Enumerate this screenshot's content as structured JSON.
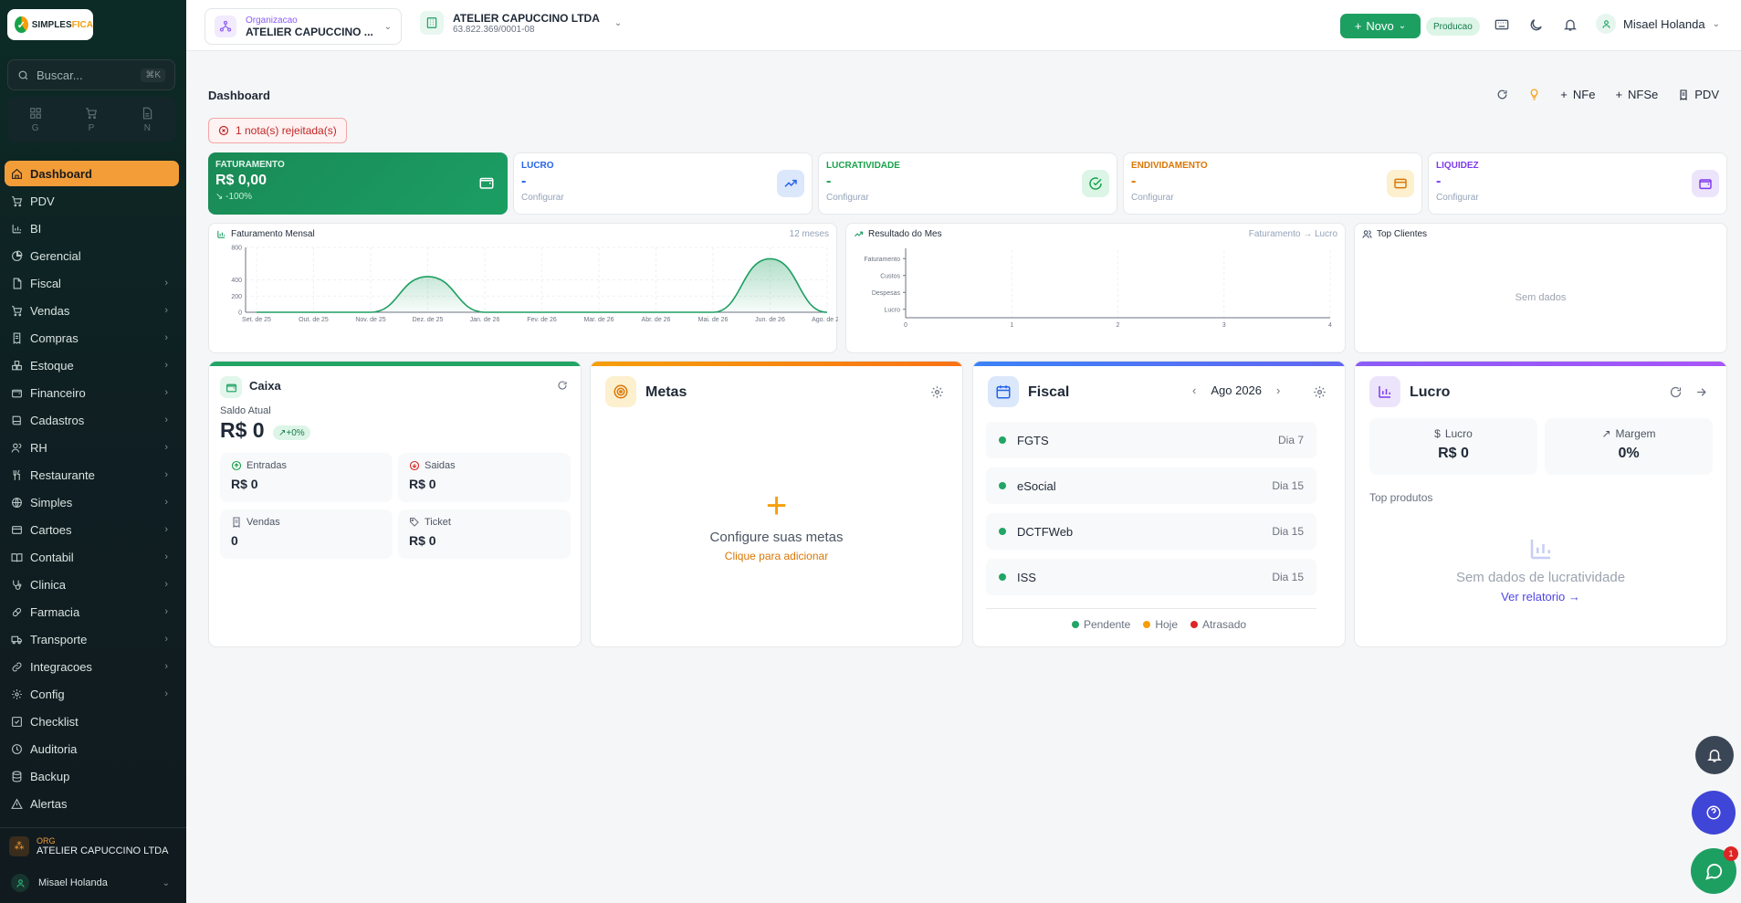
{
  "brand": {
    "logo_a": "SIMPLES",
    "logo_b": "FICA"
  },
  "sidebar": {
    "search_placeholder": "Buscar...",
    "search_shortcut": "⌘K",
    "quick": [
      {
        "label": "G"
      },
      {
        "label": "P"
      },
      {
        "label": "N"
      }
    ],
    "items": [
      {
        "label": "Dashboard",
        "icon": "home-icon"
      },
      {
        "label": "PDV",
        "icon": "cart-icon"
      },
      {
        "label": "BI",
        "icon": "bar-chart-icon"
      },
      {
        "label": "Gerencial",
        "icon": "pie-chart-icon"
      },
      {
        "label": "Fiscal",
        "icon": "file-icon"
      },
      {
        "label": "Vendas",
        "icon": "cart-icon"
      },
      {
        "label": "Compras",
        "icon": "receipt-icon"
      },
      {
        "label": "Estoque",
        "icon": "boxes-icon"
      },
      {
        "label": "Financeiro",
        "icon": "wallet-icon"
      },
      {
        "label": "Cadastros",
        "icon": "book-icon"
      },
      {
        "label": "RH",
        "icon": "users-icon"
      },
      {
        "label": "Restaurante",
        "icon": "utensils-icon"
      },
      {
        "label": "Simples",
        "icon": "globe-icon"
      },
      {
        "label": "Cartoes",
        "icon": "card-icon"
      },
      {
        "label": "Contabil",
        "icon": "book-open-icon"
      },
      {
        "label": "Clinica",
        "icon": "stethoscope-icon"
      },
      {
        "label": "Farmacia",
        "icon": "pill-icon"
      },
      {
        "label": "Transporte",
        "icon": "truck-icon"
      },
      {
        "label": "Integracoes",
        "icon": "link-icon"
      },
      {
        "label": "Config",
        "icon": "gear-icon"
      },
      {
        "label": "Checklist",
        "icon": "checklist-icon"
      },
      {
        "label": "Auditoria",
        "icon": "clock-icon"
      },
      {
        "label": "Backup",
        "icon": "database-icon"
      },
      {
        "label": "Alertas",
        "icon": "warning-icon"
      }
    ],
    "org_label": "ORG",
    "org_name": "ATELIER CAPUCCINO LTDA",
    "user_name": "Misael Holanda"
  },
  "topbar": {
    "org_caption": "Organizacao",
    "org_name": "ATELIER CAPUCCINO ...",
    "company_name": "ATELIER CAPUCCINO LTDA",
    "company_cnpj": "63.822.369/0001-08",
    "new_label": "Novo",
    "env_label": "Producao",
    "user_name": "Misael Holanda"
  },
  "page": {
    "title": "Dashboard",
    "actions": {
      "nfe": "NFe",
      "nfse": "NFSe",
      "pdv": "PDV"
    },
    "alert": "1 nota(s) rejeitada(s)"
  },
  "kpis": [
    {
      "label": "FATURAMENTO",
      "value": "R$ 0,00",
      "sub": "↘ -100%",
      "color": "#1b9e63"
    },
    {
      "label": "LUCRO",
      "value": "-",
      "sub": "Configurar",
      "color": "#2563eb"
    },
    {
      "label": "LUCRATIVIDADE",
      "value": "-",
      "sub": "Configurar",
      "color": "#16a34a"
    },
    {
      "label": "ENDIVIDAMENTO",
      "value": "-",
      "sub": "Configurar",
      "color": "#d97706"
    },
    {
      "label": "LIQUIDEZ",
      "value": "-",
      "sub": "Configurar",
      "color": "#7c3aed"
    }
  ],
  "chart_faturamento": {
    "title": "Faturamento Mensal",
    "range_label": "12 meses"
  },
  "chart_data": [
    {
      "type": "area",
      "title": "Faturamento Mensal",
      "categories": [
        "Set. de 25",
        "Out. de 25",
        "Nov. de 25",
        "Dez. de 25",
        "Jan. de 26",
        "Fev. de 26",
        "Mar. de 26",
        "Abr. de 26",
        "Mai. de 26",
        "Jun. de 26",
        "Ago. de 26"
      ],
      "values": [
        0,
        0,
        0,
        440,
        0,
        0,
        0,
        0,
        0,
        660,
        0
      ],
      "ylim": [
        0,
        800
      ],
      "yticks": [
        "0",
        "200",
        "400",
        "800"
      ],
      "grid": true,
      "color": "#1e9f62"
    },
    {
      "type": "bar",
      "title": "Resultado do Mes",
      "subtitle": "Faturamento → Lucro",
      "categories": [
        "Faturamento",
        "Custos",
        "Despesas",
        "Lucro"
      ],
      "values": [
        0,
        0,
        0,
        0
      ],
      "xlim": [
        0,
        4
      ],
      "xticks": [
        "0",
        "1",
        "2",
        "3",
        "4"
      ],
      "grid": true
    }
  ],
  "top_clientes": {
    "title": "Top Clientes",
    "empty": "Sem dados"
  },
  "caixa": {
    "title": "Caixa",
    "saldo_label": "Saldo Atual",
    "saldo": "R$ 0",
    "delta": "+0%",
    "boxes": [
      {
        "label": "Entradas",
        "value": "R$ 0",
        "icon": "arrow-up-circle-icon"
      },
      {
        "label": "Saidas",
        "value": "R$ 0",
        "icon": "arrow-down-circle-icon"
      },
      {
        "label": "Vendas",
        "value": "0",
        "icon": "receipt-icon"
      },
      {
        "label": "Ticket",
        "value": "R$ 0",
        "icon": "tag-icon"
      }
    ]
  },
  "metas": {
    "title": "Metas",
    "empty_title": "Configure suas metas",
    "empty_link": "Clique para adicionar"
  },
  "fiscal": {
    "title": "Fiscal",
    "period": "Ago 2026",
    "items": [
      {
        "name": "FGTS",
        "due": "Dia 7"
      },
      {
        "name": "eSocial",
        "due": "Dia 15"
      },
      {
        "name": "DCTFWeb",
        "due": "Dia 15"
      },
      {
        "name": "ISS",
        "due": "Dia 15"
      }
    ],
    "legend": [
      {
        "label": "Pendente",
        "color": "#22a565"
      },
      {
        "label": "Hoje",
        "color": "#f59e0b"
      },
      {
        "label": "Atrasado",
        "color": "#dc2626"
      }
    ]
  },
  "lucro": {
    "title": "Lucro",
    "boxes": [
      {
        "label": "Lucro",
        "value": "R$ 0"
      },
      {
        "label": "Margem",
        "value": "0%"
      }
    ],
    "top_label": "Top produtos",
    "empty": "Sem dados de lucratividade",
    "link": "Ver relatorio"
  },
  "chat_badge": "1"
}
